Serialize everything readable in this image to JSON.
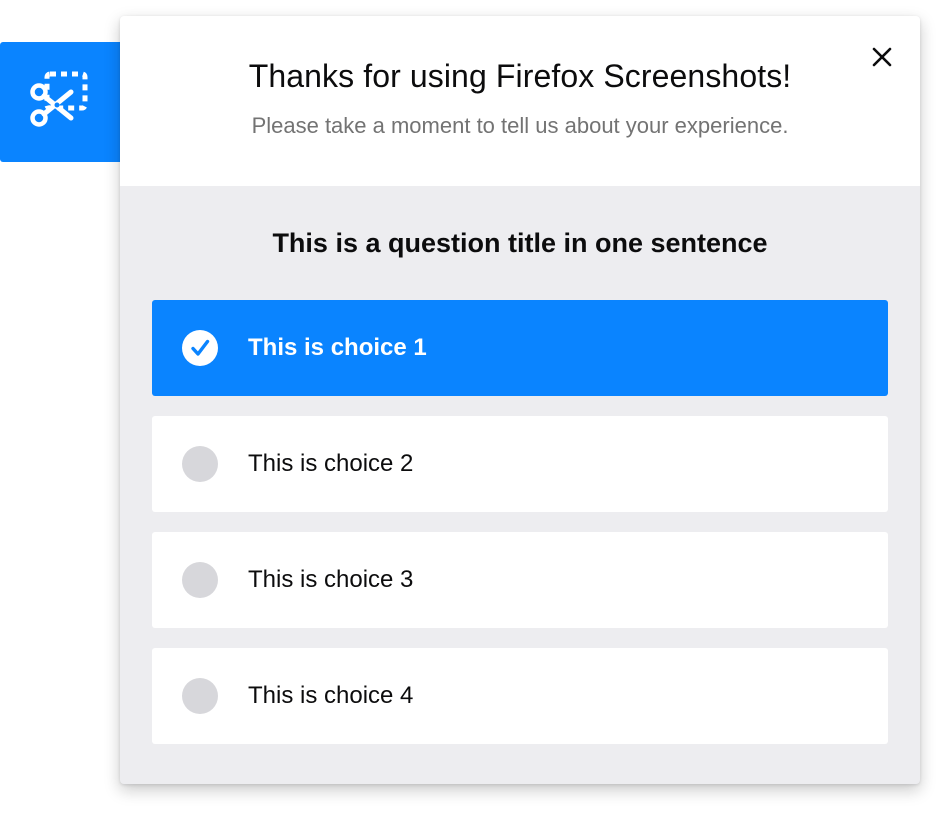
{
  "launcher": {
    "icon": "screenshot-scissors-icon",
    "color": "#0a84ff"
  },
  "panel": {
    "title": "Thanks for using Firefox Screenshots!",
    "subtitle": "Please take a moment to tell us about your experience.",
    "close_icon": "close-icon"
  },
  "survey": {
    "question": "This is a question title in one sentence",
    "choices": [
      {
        "label": "This is choice 1",
        "selected": true
      },
      {
        "label": "This is choice 2",
        "selected": false
      },
      {
        "label": "This is choice 3",
        "selected": false
      },
      {
        "label": "This is choice 4",
        "selected": false
      }
    ],
    "selected_color": "#0a84ff",
    "unselected_marker_color": "#d7d7db"
  }
}
